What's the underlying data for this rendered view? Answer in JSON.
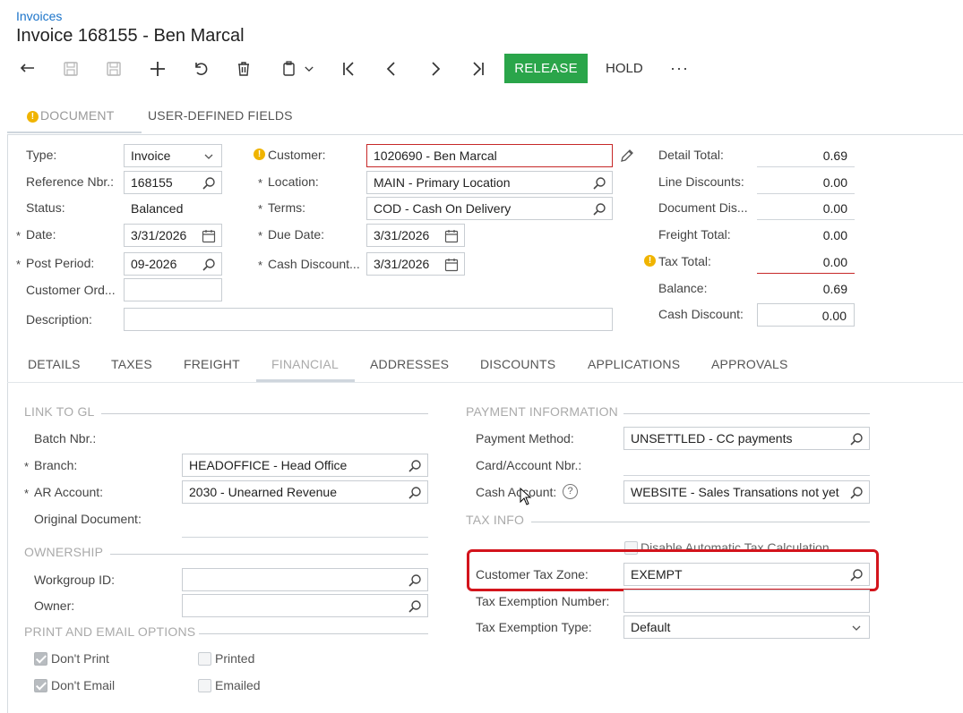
{
  "breadcrumb": "Invoices",
  "title": "Invoice 168155 - Ben Marcal",
  "toolbar": {
    "icons": [
      "back-icon",
      "save-close-icon",
      "save-icon",
      "add-icon",
      "undo-icon",
      "delete-icon",
      "copy-paste-icon",
      "first-record-icon",
      "previous-record-icon",
      "next-record-icon",
      "last-record-icon"
    ],
    "release_label": "RELEASE",
    "hold_label": "HOLD",
    "more_label": "···",
    "release_color": "#2aa54a"
  },
  "top_tabs": [
    {
      "label": "DOCUMENT",
      "active": true,
      "warning": true
    },
    {
      "label": "USER-DEFINED FIELDS",
      "active": false
    }
  ],
  "summary": {
    "type_label": "Type:",
    "type_value": "Invoice",
    "ref_label": "Reference Nbr.:",
    "ref_value": "168155",
    "status_label": "Status:",
    "status_value": "Balanced",
    "date_label": "Date:",
    "date_value": "3/31/2026",
    "post_period_label": "Post Period:",
    "post_period_value": "09-2026",
    "customer_order_label": "Customer Ord...",
    "customer_order_value": "",
    "description_label": "Description:",
    "description_value": "",
    "customer_label": "Customer:",
    "customer_value": "1020690 - Ben Marcal",
    "location_label": "Location:",
    "location_value": "MAIN - Primary Location",
    "terms_label": "Terms:",
    "terms_value": "COD - Cash On Delivery",
    "due_date_label": "Due Date:",
    "due_date_value": "3/31/2026",
    "cash_discount_date_label": "Cash Discount...",
    "cash_discount_date_value": "3/31/2026",
    "required_mark": "*",
    "warning_mark": "!"
  },
  "totals": {
    "detail_total_label": "Detail Total:",
    "detail_total": "0.69",
    "line_discounts_label": "Line Discounts:",
    "line_discounts": "0.00",
    "document_discount_label": "Document Dis...",
    "document_discount": "0.00",
    "freight_total_label": "Freight Total:",
    "freight_total": "0.00",
    "tax_total_label": "Tax Total:",
    "tax_total": "0.00",
    "balance_label": "Balance:",
    "balance": "0.69",
    "cash_discount_label": "Cash Discount:",
    "cash_discount": "0.00"
  },
  "sub_tabs": [
    "DETAILS",
    "TAXES",
    "FREIGHT",
    "FINANCIAL",
    "ADDRESSES",
    "DISCOUNTS",
    "APPLICATIONS",
    "APPROVALS"
  ],
  "sub_tabs_active": "FINANCIAL",
  "financial": {
    "link_to_gl_title": "LINK TO GL",
    "batch_nbr_label": "Batch Nbr.:",
    "batch_nbr_value": "",
    "branch_label": "Branch:",
    "branch_value": "HEADOFFICE - Head Office",
    "ar_account_label": "AR Account:",
    "ar_account_value": "2030 - Unearned Revenue",
    "original_document_label": "Original Document:",
    "original_document_value": "",
    "ownership_title": "OWNERSHIP",
    "workgroup_label": "Workgroup ID:",
    "workgroup_value": "",
    "owner_label": "Owner:",
    "owner_value": "",
    "print_email_title": "PRINT AND EMAIL OPTIONS",
    "dont_print_label": "Don't Print",
    "dont_print_checked": true,
    "printed_label": "Printed",
    "printed_checked": false,
    "dont_email_label": "Don't Email",
    "dont_email_checked": true,
    "emailed_label": "Emailed",
    "emailed_checked": false,
    "payment_info_title": "PAYMENT INFORMATION",
    "payment_method_label": "Payment Method:",
    "payment_method_value": "UNSETTLED - CC payments",
    "card_account_label": "Card/Account Nbr.:",
    "card_account_value": "",
    "cash_account_label": "Cash Account:",
    "cash_account_value": "WEBSITE - Sales Transations not yet",
    "help_mark": "?",
    "tax_info_title": "TAX INFO",
    "disable_auto_tax_label": "Disable Automatic Tax Calculation",
    "disable_auto_tax_checked": false,
    "customer_tax_zone_label": "Customer Tax Zone:",
    "customer_tax_zone_value": "EXEMPT",
    "tax_exemption_number_label": "Tax Exemption Number:",
    "tax_exemption_number_value": "",
    "tax_exemption_type_label": "Tax Exemption Type:",
    "tax_exemption_type_value": "Default",
    "highlight_color": "#d3141c"
  }
}
